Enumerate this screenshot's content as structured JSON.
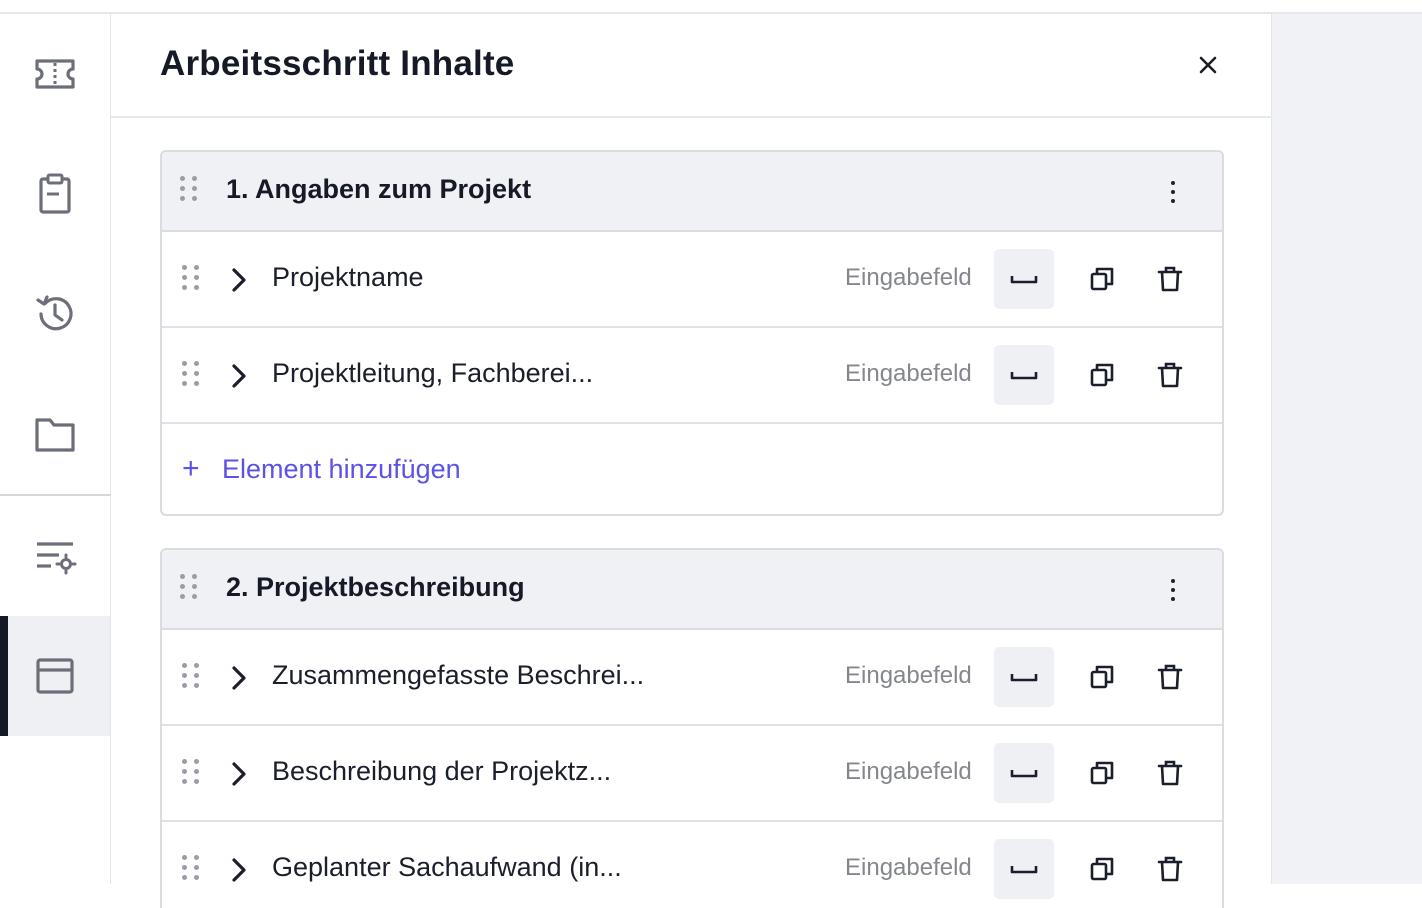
{
  "sidebar": {
    "items": [
      {
        "icon": "ticket-icon"
      },
      {
        "icon": "clipboard-icon"
      },
      {
        "icon": "history-icon"
      },
      {
        "icon": "folder-icon"
      },
      {
        "icon": "list-settings-icon"
      },
      {
        "icon": "layout-icon",
        "active": true
      }
    ]
  },
  "panel": {
    "title": "Arbeitsschritt Inhalte",
    "close_icon": "close-icon"
  },
  "sections": [
    {
      "title": "1. Angaben zum Projekt",
      "rows": [
        {
          "label": "Projektname",
          "type": "Eingabefeld"
        },
        {
          "label": "Projektleitung, Fachberei...",
          "type": "Eingabefeld"
        }
      ],
      "add_label": "Element hinzufügen",
      "add_icon": "+"
    },
    {
      "title": "2. Projektbeschreibung",
      "rows": [
        {
          "label": "Zusammengefasste Beschrei...",
          "type": "Eingabefeld"
        },
        {
          "label": "Beschreibung der Projektz...",
          "type": "Eingabefeld"
        },
        {
          "label": "Geplanter Sachaufwand (in...",
          "type": "Eingabefeld"
        }
      ]
    }
  ],
  "colors": {
    "accent": "#5b52e8",
    "rail_active_bar": "#151826",
    "section_head_bg": "#f0f1f5"
  }
}
